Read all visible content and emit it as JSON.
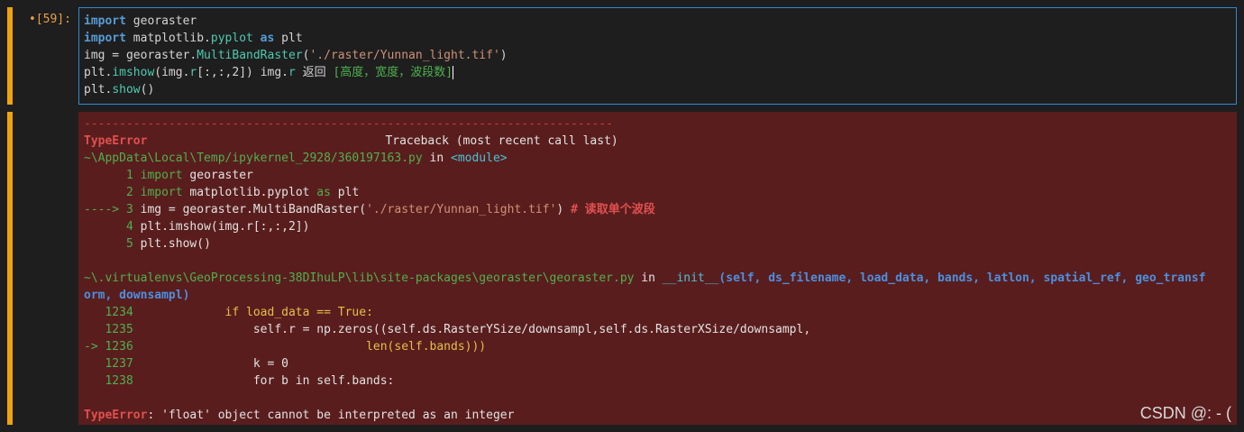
{
  "cell_prompt": "•[59]:",
  "code_lines": [
    {
      "a": "import",
      "b": " georaster"
    },
    {
      "a": "import",
      "b": " matplotlib.",
      "c": "pyplot",
      "d": " as",
      "e": " plt"
    },
    {
      "a": "img = georaster.",
      "b": "MultiBandRaster",
      "c": "(",
      "d": "'./raster/Yunnan_light.tif'",
      "e": ")"
    },
    {
      "a": "plt.",
      "b": "imshow",
      "c": "(img.",
      "d": "r",
      "e": "[:,:,2]) img.",
      "f": "r",
      "g": " 返回 ",
      "h": "[高度，宽度，波段数]"
    },
    {
      "a": "plt.",
      "b": "show",
      "c": "()"
    }
  ],
  "traceback": {
    "separator": "---------------------------------------------------------------------------",
    "error_name": "TypeError",
    "header_right": "Traceback (most recent call last)",
    "frame1_path": "~\\AppData\\Local\\Temp/ipykernel_2928/360197163.py",
    "frame1_in": " in ",
    "frame1_module": "<module>",
    "frame1_lines": [
      {
        "no": "      1 ",
        "kw": "import",
        "rest": " georaster"
      },
      {
        "no": "      2 ",
        "kw": "import",
        "rest": " matplotlib.pyplot",
        "kw2": " as",
        "rest2": " plt"
      },
      {
        "no": "----> 3 ",
        "pre": "img = georaster.MultiBandRaster(",
        "str": "'./raster/Yunnan_light.tif'",
        "post": ") ",
        "cmt": "# 读取单个波段"
      },
      {
        "no": "      4 ",
        "pre": "plt.imshow(img.r[:,:,2])"
      },
      {
        "no": "      5 ",
        "pre": "plt.show()"
      }
    ],
    "frame2_path": "~\\.virtualenvs\\GeoProcessing-38DIhuLP\\lib\\site-packages\\georaster\\georaster.py",
    "frame2_in": " in ",
    "frame2_func": "__init__",
    "frame2_args_line1": "(self, ds_filename, load_data, bands, latlon, spatial_ref, geo_transf",
    "frame2_args_line2": "orm, downsampl)",
    "frame2_lines": [
      {
        "no": "   1234 ",
        "code": "            if load_data == True:"
      },
      {
        "no": "   1235 ",
        "code": "                self.r = np.zeros((self.ds.RasterYSize/downsampl,self.ds.RasterXSize/downsampl,"
      },
      {
        "no": "-> 1236 ",
        "code": "                                len(self.bands)))"
      },
      {
        "no": "   1237 ",
        "code": "                k = 0"
      },
      {
        "no": "   1238 ",
        "code": "                for b in self.bands:"
      }
    ],
    "final_error_name": "TypeError",
    "final_error_msg": ": 'float' object cannot be interpreted as an integer"
  },
  "watermark": "CSDN @: - ("
}
